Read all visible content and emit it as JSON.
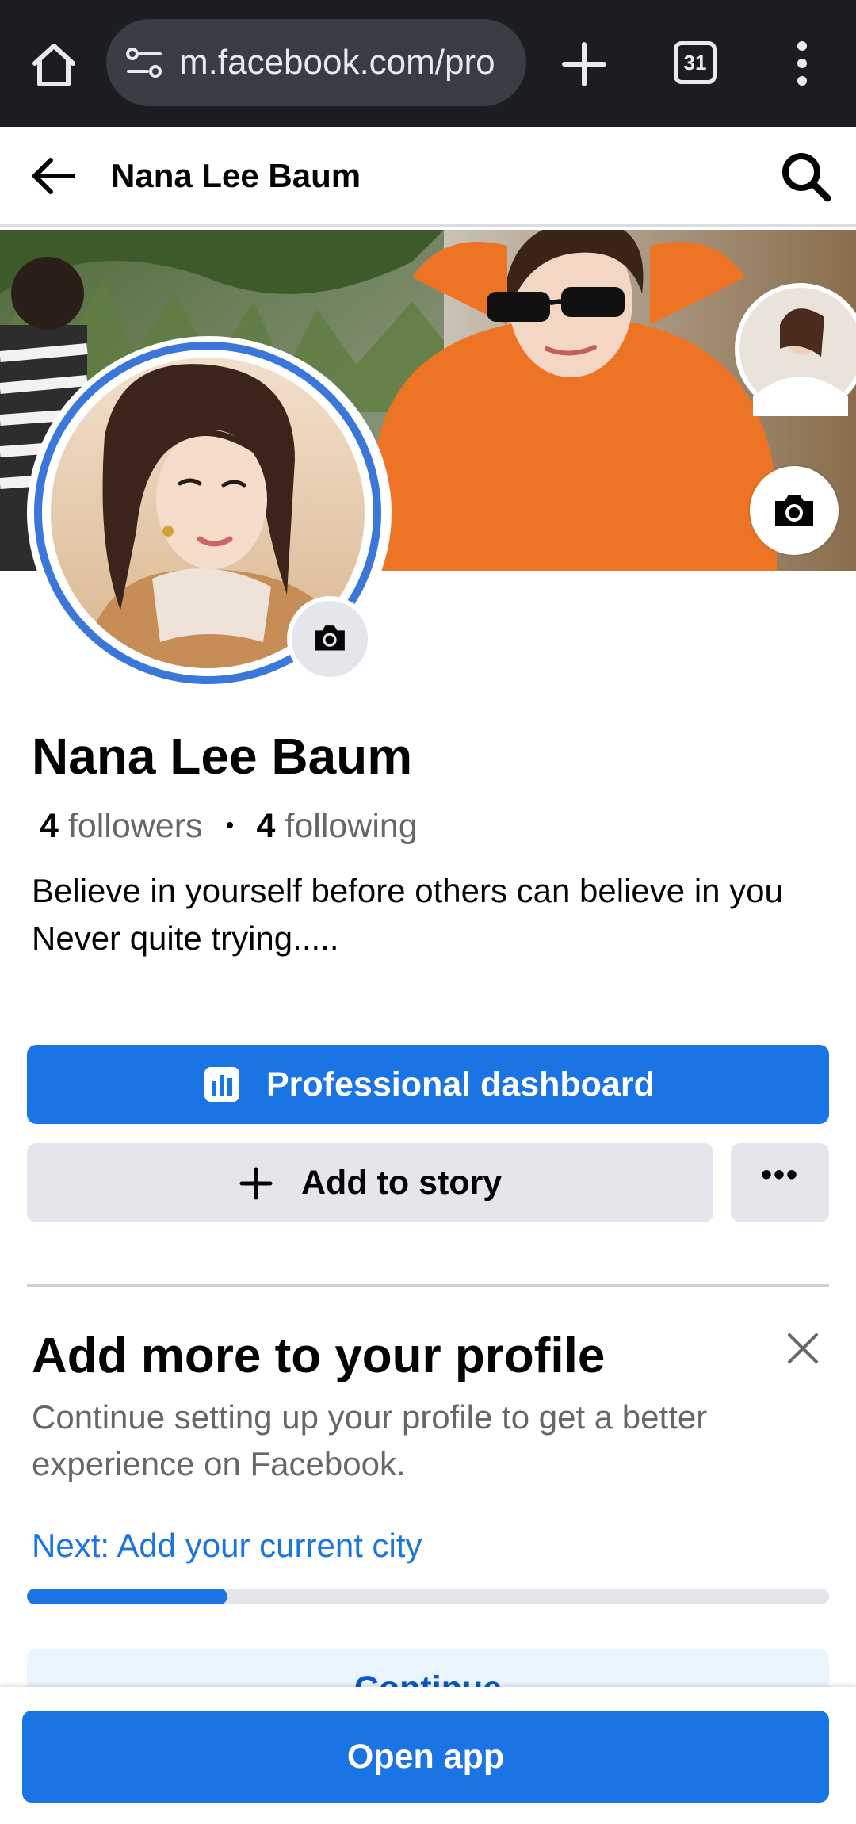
{
  "browser": {
    "url": "m.facebook.com/pro",
    "tab_count": "31",
    "icons": [
      "home-icon",
      "site-info-icon",
      "plus-icon",
      "tabs-icon",
      "more-vertical-icon"
    ]
  },
  "header": {
    "title": "Nana Lee Baum",
    "icons": [
      "back-arrow-icon",
      "search-icon"
    ]
  },
  "profile": {
    "name": "Nana Lee Baum",
    "followers_count": "4",
    "followers_label": "followers",
    "following_count": "4",
    "following_label": "following",
    "bio_line1": "Believe in yourself before others can believe in you",
    "bio_line2": "Never quite trying....."
  },
  "actions": {
    "dashboard_label": "Professional dashboard",
    "add_story_label": "Add to story",
    "more_label": "•••"
  },
  "profile_prompt": {
    "title": "Add more to your profile",
    "description": "Continue setting up your profile to get a better experience on Facebook.",
    "next_step": "Next: Add your current city",
    "progress_fraction": 0.25,
    "continue_label": "Continue"
  },
  "bottom": {
    "open_app_label": "Open app"
  },
  "colors": {
    "facebook_blue": "#1b74e4",
    "button_gray": "#e4e6eb",
    "secondary_text": "#65676b",
    "browser_dark": "#1c1d21"
  }
}
